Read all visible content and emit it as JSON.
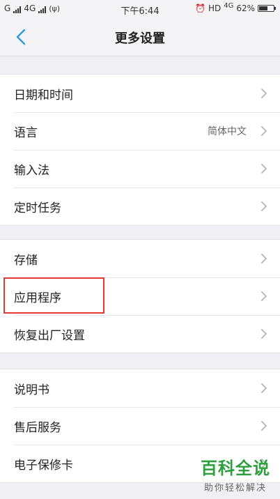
{
  "status_bar": {
    "carrier_left": "G",
    "network_mid": "4G",
    "time": "下午6:44",
    "hd": "HD",
    "network_right": "4G",
    "battery_percent": "62%",
    "battery_level": 0.62
  },
  "nav": {
    "title": "更多设置"
  },
  "groups": [
    [
      {
        "label": "日期和时间",
        "value": ""
      },
      {
        "label": "语言",
        "value": "简体中文"
      },
      {
        "label": "输入法",
        "value": ""
      },
      {
        "label": "定时任务",
        "value": ""
      }
    ],
    [
      {
        "label": "存储",
        "value": ""
      },
      {
        "label": "应用程序",
        "value": ""
      },
      {
        "label": "恢复出厂设置",
        "value": ""
      }
    ],
    [
      {
        "label": "说明书",
        "value": ""
      },
      {
        "label": "售后服务",
        "value": ""
      },
      {
        "label": "电子保修卡",
        "value": ""
      }
    ]
  ],
  "watermark": {
    "main": "百科全说",
    "sub": "助你轻松解决"
  },
  "colors": {
    "accent": "#2d9cdb",
    "highlight": "#e53935",
    "watermark": "#2e9f3e"
  }
}
